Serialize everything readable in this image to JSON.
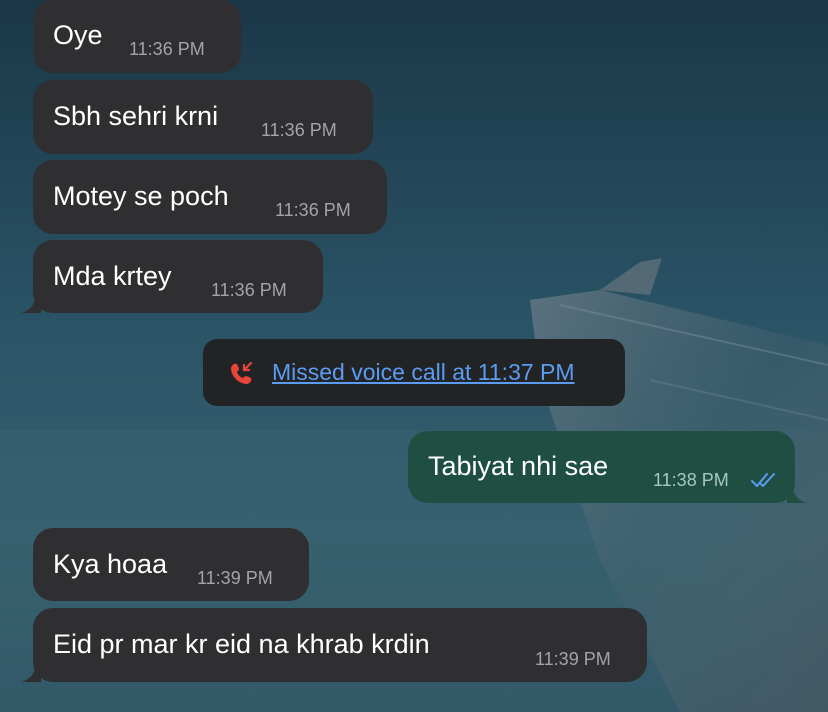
{
  "messages": [
    {
      "text": "Oye",
      "time": "11:36 PM"
    },
    {
      "text": "Sbh sehri krni",
      "time": "11:36 PM"
    },
    {
      "text": "Motey se poch",
      "time": "11:36 PM"
    },
    {
      "text": "Mda krtey",
      "time": "11:36 PM"
    },
    {
      "text": "Tabiyat nhi sae",
      "time": "11:38 PM",
      "read_status_icon": "double-check-icon"
    },
    {
      "text": "Kya hoaa",
      "time": "11:39 PM"
    },
    {
      "text": "Eid pr mar kr eid na khrab krdin",
      "time": "11:39 PM"
    }
  ],
  "system_message": {
    "icon": "missed-call-icon",
    "text": "Missed voice call at 11:37 PM"
  },
  "colors": {
    "incoming_bubble": "#2f2f31",
    "outgoing_bubble": "#1f4f43",
    "link_blue": "#5b9cf2",
    "missed_red": "#e8443a",
    "read_tick_blue": "#5b9cf2",
    "system_pill": "#222325"
  }
}
